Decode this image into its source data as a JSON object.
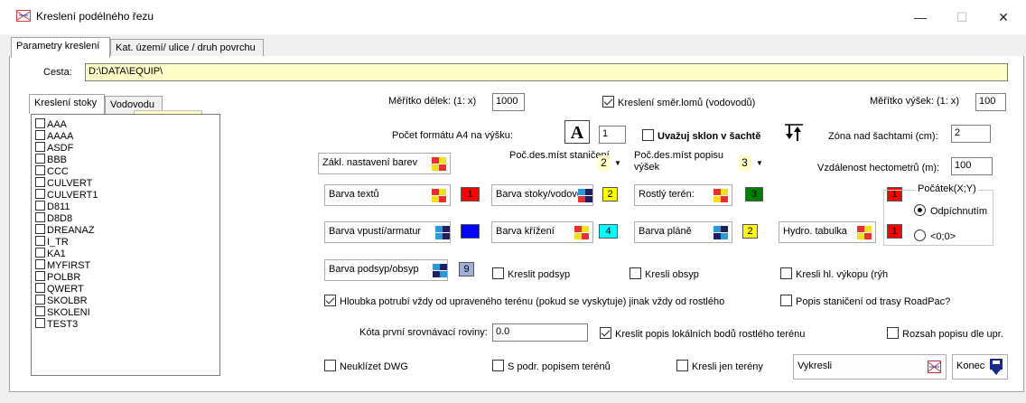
{
  "window": {
    "title": "Kreslení podélného řezu",
    "controls": {
      "minimize": "—",
      "maximize": "☐",
      "close": "✕"
    }
  },
  "tabs": [
    "Parametry kreslení",
    "Kat. území/ ulice / druh povrchu"
  ],
  "path": {
    "label": "Cesta:",
    "value": "D:\\DATA\\EQUIP\\"
  },
  "subtabs": [
    "Kreslení stoky",
    "Vodovodu"
  ],
  "list_items": [
    "AAA",
    "AAAA",
    "ASDF",
    "BBB",
    "CCC",
    "CULVERT",
    "CULVERT1",
    "D811",
    "D8D8",
    "DREANAZ",
    "I_TR",
    "KA1",
    "MYFIRST",
    "POLBR",
    "QWERT",
    "SKOLBR",
    "SKOLENI",
    "TEST3"
  ],
  "scale_length": {
    "label": "Měřítko délek: (1: x)",
    "value": "1000"
  },
  "draw_breaks": {
    "label": "Kreslení směr.lomů (vodovodů)",
    "checked": true
  },
  "scale_height": {
    "label": "Měřítko výšek: (1: x)",
    "value": "100"
  },
  "a4_count": {
    "label": "Počet formátu A4 na výšku:",
    "value": "1",
    "icon_letter": "A"
  },
  "slope": {
    "label": "Uvažuj sklon v šachtě",
    "checked": false
  },
  "zone": {
    "label": "Zóna nad šachtami (cm):",
    "value": "2"
  },
  "base_colors": {
    "label": "Zákl. nastavení barev"
  },
  "decimals_station": {
    "label": "Poč.des.míst staničení",
    "value": "2"
  },
  "decimals_height": {
    "label": "Poč.des.míst popisu výšek",
    "value": "3"
  },
  "hecto_distance": {
    "label": "Vzdálenost hectometrů (m):",
    "value": "100"
  },
  "color_buttons": {
    "text": {
      "label": "Barva textů",
      "num": "1",
      "color": "#ff0000"
    },
    "stoky": {
      "label": "Barva stoky/vodovodu",
      "num": "2",
      "color": "#ffff00"
    },
    "terrain": {
      "label": "Rostlý terén:",
      "num": "3",
      "color": "#008000"
    },
    "origin": {
      "num": "1",
      "color": "#ff0000"
    },
    "vpusti": {
      "label": "Barva vpustí/armatur",
      "num": "5",
      "color": "#0000ff"
    },
    "krizeni": {
      "label": "Barva křížení",
      "num": "4",
      "color": "#00ffff"
    },
    "plane": {
      "label": "Barva pláně",
      "num": "2",
      "color": "#ffff00"
    },
    "hydro": {
      "label": "Hydro. tabulka",
      "num": "1",
      "color": "#ff0000"
    },
    "podsyp": {
      "label": "Barva podsyp/obsyp",
      "num": "9",
      "color": "#a0b0e0"
    }
  },
  "origin_group": {
    "title": "Počátek(X;Y)",
    "options": [
      {
        "label": "Odpíchnutím",
        "checked": true
      },
      {
        "label": "<0;0>",
        "checked": false
      }
    ]
  },
  "checks": {
    "kreslit_podsyp": {
      "label": "Kreslit podsyp",
      "checked": false
    },
    "kresli_obsyp": {
      "label": "Kresli obsyp",
      "checked": false
    },
    "kresli_vykop": {
      "label": "Kresli hl. výkopu (rýh",
      "checked": false
    },
    "hloubka": {
      "label": "Hloubka potrubí vždy od upraveného terénu (pokud se vyskytuje) jinak vždy od rostlého",
      "checked": true
    },
    "popis_stanic": {
      "label": "Popis staničení od trasy RoadPac?",
      "checked": false
    },
    "kreslit_popis": {
      "label": "Kreslit popis lokálních bodů rostlého terénu",
      "checked": true
    },
    "rozsah": {
      "label": "Rozsah popisu dle upr.",
      "checked": false
    },
    "neuklizet": {
      "label": "Neuklízet DWG",
      "checked": false
    },
    "s_podr": {
      "label": "S podr. popisem terénů",
      "checked": false
    },
    "jen_tereny": {
      "label": "Kresli jen terény",
      "checked": false
    }
  },
  "reference_plane": {
    "label": "Kóta první srovnávací roviny:",
    "value": "0.0"
  },
  "actions": {
    "draw": "Vykresli",
    "end": "Konec"
  }
}
